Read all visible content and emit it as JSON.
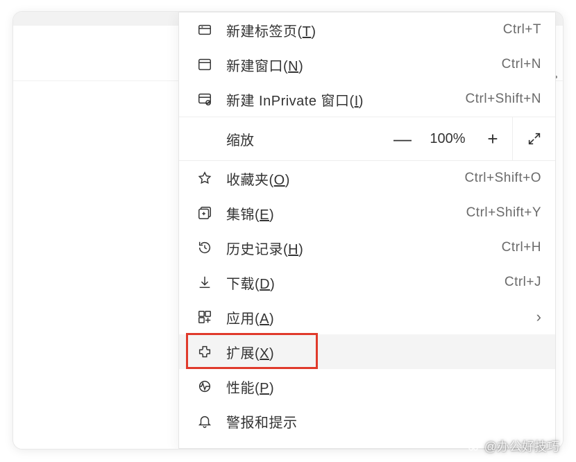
{
  "menu": {
    "new_tab": {
      "label": "新建标签页(",
      "accel": "T",
      "suffix": ")",
      "shortcut": "Ctrl+T"
    },
    "new_window": {
      "label": "新建窗口(",
      "accel": "N",
      "suffix": ")",
      "shortcut": "Ctrl+N"
    },
    "new_inprivate": {
      "label": "新建 InPrivate 窗口(",
      "accel": "I",
      "suffix": ")",
      "shortcut": "Ctrl+Shift+N"
    },
    "zoom": {
      "label": "缩放",
      "value": "100%",
      "minus": "—",
      "plus": "+"
    },
    "favorites": {
      "label": "收藏夹(",
      "accel": "O",
      "suffix": ")",
      "shortcut": "Ctrl+Shift+O"
    },
    "collections": {
      "label": "集锦(",
      "accel": "E",
      "suffix": ")",
      "shortcut": "Ctrl+Shift+Y"
    },
    "history": {
      "label": "历史记录(",
      "accel": "H",
      "suffix": ")",
      "shortcut": "Ctrl+H"
    },
    "downloads": {
      "label": "下载(",
      "accel": "D",
      "suffix": ")",
      "shortcut": "Ctrl+J"
    },
    "apps": {
      "label": "应用(",
      "accel": "A",
      "suffix": ")"
    },
    "extensions": {
      "label": "扩展(",
      "accel": "X",
      "suffix": ")"
    },
    "performance": {
      "label": "性能(",
      "accel": "P",
      "suffix": ")"
    },
    "alerts": {
      "label": "警报和提示"
    }
  },
  "watermark": {
    "text": "@办公好技巧"
  }
}
